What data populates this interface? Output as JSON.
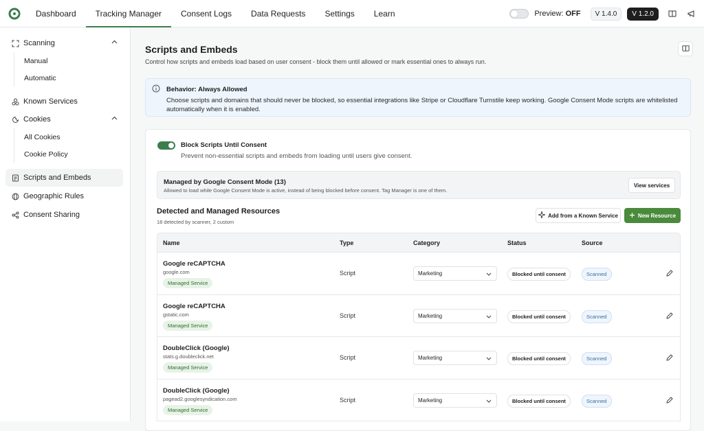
{
  "topbar": {
    "logo": "logo-icon",
    "nav": [
      "Dashboard",
      "Tracking Manager",
      "Consent Logs",
      "Data Requests",
      "Settings",
      "Learn"
    ],
    "active_nav": "Tracking Manager",
    "preview_label": "Preview:",
    "preview_state": "OFF",
    "version_plugin": "V 1.4.0",
    "version_app": "V 1.2.0",
    "icons": [
      "book-icon",
      "megaphone-icon"
    ]
  },
  "sidebar": {
    "scanning": "Scanning",
    "scanning_items": [
      "Manual",
      "Automatic"
    ],
    "known_services": "Known Services",
    "cookies": "Cookies",
    "cookies_items": [
      "All Cookies",
      "Cookie Policy"
    ],
    "scripts": "Scripts and Embeds",
    "geo": "Geographic Rules",
    "sharing": "Consent Sharing"
  },
  "page": {
    "title": "Scripts and Embeds",
    "subtitle": "Control how scripts and embeds load based on user consent - block them until allowed or mark essential ones to always run."
  },
  "info": {
    "title": "Behavior: Always Allowed",
    "text": "Choose scripts and domains that should never be blocked, so essential integrations like Stripe or Cloudflare Turnstile keep working. Google Consent Mode scripts are whitelisted automatically when it is enabled."
  },
  "block": {
    "title": "Block Scripts Until Consent",
    "desc": "Prevent non-essential scripts and embeds from loading until users give consent.",
    "enabled": true
  },
  "gcm": {
    "title": "Managed by Google Consent Mode (13)",
    "desc": "Allowed to load while Google Consent Mode is active, instead of being blocked before consent. Tag Manager is one of them.",
    "button": "View services"
  },
  "resources": {
    "title": "Detected and Managed Resources",
    "subtitle": "18 detected by scanner, 2 custom",
    "add_known": "Add from a Known Service",
    "new_resource": "New Resource",
    "columns": [
      "Name",
      "Type",
      "Category",
      "Status",
      "Source"
    ],
    "rows": [
      {
        "name": "Google reCAPTCHA",
        "domain": "google.com",
        "badge": "Managed Service",
        "type": "Script",
        "category": "Marketing",
        "status": "Blocked until consent",
        "source": "Scanned"
      },
      {
        "name": "Google reCAPTCHA",
        "domain": "gstatic.com",
        "badge": "Managed Service",
        "type": "Script",
        "category": "Marketing",
        "status": "Blocked until consent",
        "source": "Scanned"
      },
      {
        "name": "DoubleClick (Google)",
        "domain": "stats.g.doubleclick.net",
        "badge": "Managed Service",
        "type": "Script",
        "category": "Marketing",
        "status": "Blocked until consent",
        "source": "Scanned"
      },
      {
        "name": "DoubleClick (Google)",
        "domain": "pagead2.googlesyndication.com",
        "badge": "Managed Service",
        "type": "Script",
        "category": "Marketing",
        "status": "Blocked until consent",
        "source": "Scanned"
      }
    ]
  },
  "colors": {
    "accent": "#3b7d4c",
    "primary_button": "#4a8a3c",
    "info_bg": "#eef5fc"
  }
}
